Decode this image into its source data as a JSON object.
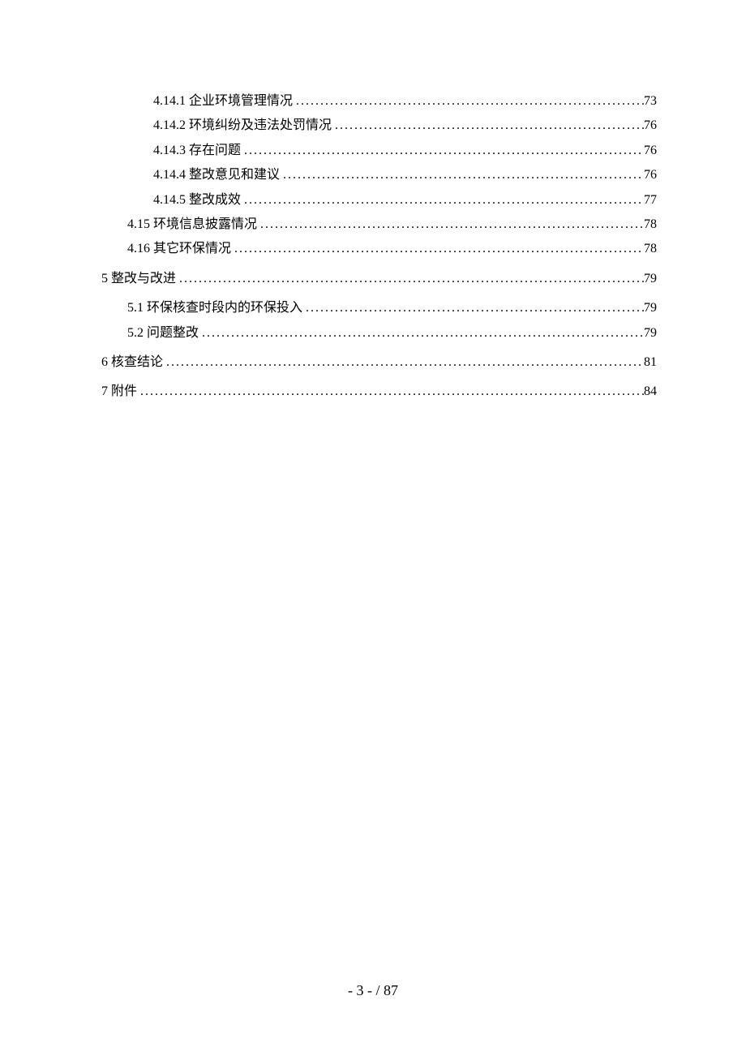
{
  "toc": [
    {
      "level": 3,
      "label": "4.14.1 企业环境管理情况",
      "page": "73"
    },
    {
      "level": 3,
      "label": "4.14.2 环境纠纷及违法处罚情况",
      "page": "76"
    },
    {
      "level": 3,
      "label": "4.14.3 存在问题",
      "page": "76"
    },
    {
      "level": 3,
      "label": "4.14.4 整改意见和建议",
      "page": "76"
    },
    {
      "level": 3,
      "label": "4.14.5 整改成效",
      "page": "77"
    },
    {
      "level": 2,
      "label": "4.15 环境信息披露情况",
      "page": "78"
    },
    {
      "level": 2,
      "label": "4.16 其它环保情况",
      "page": "78"
    },
    {
      "level": 1,
      "label": "5 整改与改进",
      "page": "79",
      "spacer_before": true
    },
    {
      "level": 2,
      "label": "5.1 环保核查时段内的环保投入",
      "page": "79",
      "spacer_before": true
    },
    {
      "level": 2,
      "label": "5.2 问题整改",
      "page": "79"
    },
    {
      "level": 1,
      "label": "6 核查结论",
      "page": "81",
      "spacer_before": true
    },
    {
      "level": 1,
      "label": "7 附件",
      "page": "84",
      "spacer_before": true
    }
  ],
  "footer": "- 3 -  / 87"
}
